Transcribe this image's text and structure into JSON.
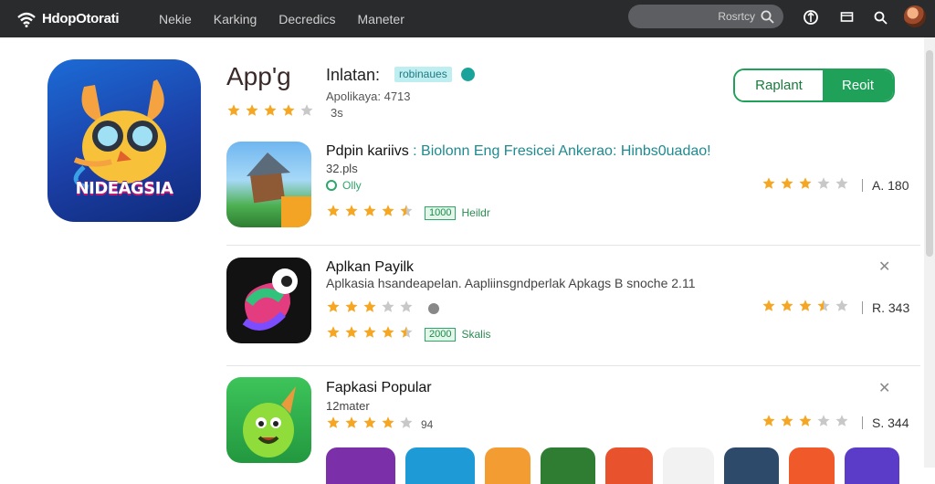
{
  "topbar": {
    "brand": "HdopOtorati",
    "nav": [
      "Nekie",
      "Karking",
      "Decredics",
      "Maneter"
    ],
    "search_placeholder": "Rosrtcy"
  },
  "app": {
    "icon_text": "NIDEAGSIA",
    "title": "App'g",
    "rating_value": "3s",
    "developer": "Inlatan:",
    "developer_badge": "robinaues",
    "developer_sub": "Apolikaya: 4713",
    "button_secondary": "Raplant",
    "button_primary": "Reoit"
  },
  "list": [
    {
      "title_main": "Pdpin kariivs",
      "title_accent": ": Biolonn Eng Fresicei Ankerao: Hinbs0uadao!",
      "sub": "32.pls",
      "line2": "Olly",
      "tag": "1000",
      "tag_label": "Heildr",
      "right_value": "A. 180"
    },
    {
      "title_main": "Aplkan Payilk",
      "sub": "Aplkasia hsandeapelan. Aapliinsgndperlak Apkags B snoche 2.11",
      "line2": "",
      "tag": "2000",
      "tag_label": "Skalis",
      "right_value": "R. 343"
    },
    {
      "title_main": "Fapkasi Popular",
      "sub": "12mater",
      "line2": "94",
      "right_value": "S. 344"
    }
  ],
  "colors": {
    "topbar": "#2a2b2d",
    "accent_green": "#1fa15a",
    "star": "#f5a623"
  }
}
